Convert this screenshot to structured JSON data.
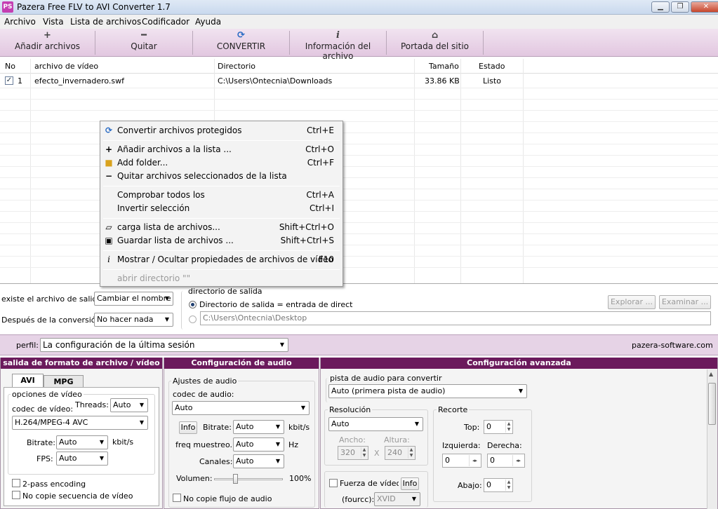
{
  "window": {
    "title": "Pazera Free FLV to AVI Converter 1.7",
    "icon_text": "PS",
    "minimize": "▁",
    "maximize": "❐",
    "close": "✕"
  },
  "menu": {
    "items": [
      "Archivo",
      "Vista",
      "Lista de archivos",
      "Codificador",
      "Ayuda"
    ]
  },
  "toolbar": {
    "add": {
      "label": "Añadir archivos",
      "icon": "plus-icon",
      "glyph": "+"
    },
    "remove": {
      "label": "Quitar",
      "icon": "minus-icon",
      "glyph": "━"
    },
    "convert": {
      "label": "CONVERTIR",
      "icon": "convert-icon",
      "glyph": "⟳"
    },
    "info": {
      "label": "Información del archivo",
      "icon": "info-icon",
      "glyph": "i"
    },
    "home": {
      "label": "Portada del sitio",
      "icon": "home-icon",
      "glyph": "⌂"
    }
  },
  "file_list": {
    "columns": [
      "No",
      "archivo de vídeo",
      "Directorio",
      "Tamaño",
      "Estado"
    ],
    "rows": [
      {
        "checked": true,
        "no": "1",
        "file": "efecto_invernadero.swf",
        "dir": "C:\\Users\\Ontecnia\\Downloads",
        "size": "33.86 KB",
        "status": "Listo"
      }
    ]
  },
  "context_menu": {
    "items": [
      {
        "label": "Convertir archivos protegidos",
        "shortcut": "Ctrl+E",
        "icon": "convert-icon"
      },
      {
        "label": "Añadir archivos a la lista ...",
        "shortcut": "Ctrl+O",
        "icon": "plus-icon"
      },
      {
        "label": "Add folder...",
        "shortcut": "Ctrl+F",
        "icon": "folder-icon"
      },
      {
        "label": "Quitar archivos seleccionados de la lista",
        "shortcut": "",
        "icon": "minus-icon"
      },
      {
        "label": "Comprobar todos los",
        "shortcut": "Ctrl+A",
        "icon": ""
      },
      {
        "label": "Invertir selección",
        "shortcut": "Ctrl+I",
        "icon": ""
      },
      {
        "label": "carga lista de archivos...",
        "shortcut": "Shift+Ctrl+O",
        "icon": "open-folder-icon"
      },
      {
        "label": "Guardar lista de archivos ...",
        "shortcut": "Shift+Ctrl+S",
        "icon": "save-icon"
      },
      {
        "label": "Mostrar / Ocultar propiedades de archivos de vídeo",
        "shortcut": "F10",
        "icon": "info-icon"
      },
      {
        "label": "abrir directorio \"\"",
        "shortcut": "",
        "icon": "",
        "disabled": true
      }
    ]
  },
  "output": {
    "exists_label": "existe el archivo de salida:",
    "exists_value": "Cambiar el nombre",
    "after_label": "Después de la conversión:",
    "after_value": "No hacer nada",
    "dir_group": "directorio de salida",
    "radio_same": "Directorio de salida = entrada de direct",
    "custom_dir": "C:\\Users\\Ontecnia\\Desktop",
    "browse": "Explorar ...",
    "examine": "Examinar ..."
  },
  "profile": {
    "label": "perfil:",
    "value": "La configuración de la última sesión",
    "site": "pazera-software.com"
  },
  "format_panel": {
    "title": "salida de formato de archivo / vídeo",
    "tabs": [
      "AVI",
      "MPG"
    ],
    "group": "opciones de vídeo",
    "codec_label": "codec de vídeo:",
    "threads_label": "Threads:",
    "threads_value": "Auto",
    "codec_value": "H.264/MPEG-4 AVC",
    "bitrate_label": "Bitrate:",
    "bitrate_value": "Auto",
    "bitrate_unit": "kbit/s",
    "fps_label": "FPS:",
    "fps_value": "Auto",
    "two_pass": "2-pass encoding",
    "no_copy": "No copie secuencia de vídeo"
  },
  "audio_panel": {
    "title": "Configuración de audio",
    "group": "Ajustes de audio",
    "codec_label": "codec de audio:",
    "codec_value": "Auto",
    "info": "Info",
    "bitrate_label": "Bitrate:",
    "bitrate_value": "Auto",
    "bitrate_unit": "kbit/s",
    "freq_label": "freq muestreo.:",
    "freq_value": "Auto",
    "freq_unit": "Hz",
    "channels_label": "Canales:",
    "channels_value": "Auto",
    "volume_label": "Volumen:",
    "volume_value": "100%",
    "volume_level": 0.3,
    "no_copy": "No copie flujo de audio"
  },
  "advanced_panel": {
    "title": "Configuración avanzada",
    "track_label": "pista de audio para convertir",
    "track_value": "Auto (primera pista de audio)",
    "res_group": "Resolución",
    "res_value": "Auto",
    "width_label": "Ancho:",
    "width_value": "320",
    "height_label": "Altura:",
    "height_value": "240",
    "x": "X",
    "crop_group": "Recorte",
    "top_label": "Top:",
    "top_value": "0",
    "left_label": "Izquierda:",
    "left_value": "0",
    "right_label": "Derecha:",
    "right_value": "0",
    "bottom_label": "Abajo:",
    "bottom_value": "0",
    "force_label": "Fuerza de vídeo",
    "fourcc_label": "(fourcc):",
    "fourcc_value": "XVID",
    "info": "Info"
  },
  "colors": {
    "accent": "#6b1a5c",
    "toolbar": "#e2c7e0"
  }
}
